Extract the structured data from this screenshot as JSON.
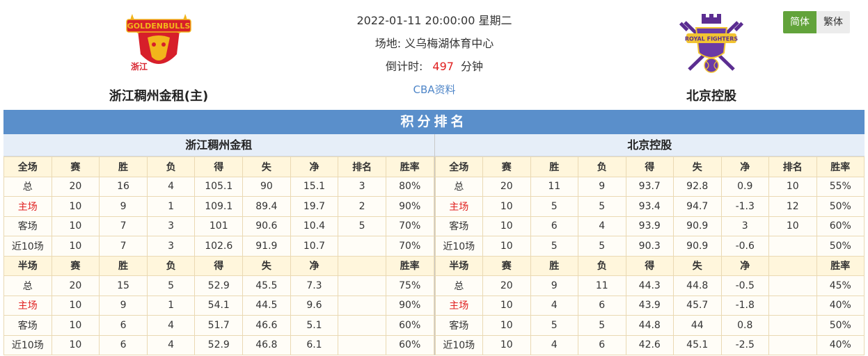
{
  "match": {
    "datetime": "2022-01-11 20:00:00 星期二",
    "venue_label": "场地:",
    "venue": "义乌梅湖体育中心",
    "countdown_label": "倒计时:",
    "countdown_value": "497",
    "countdown_unit": "分钟",
    "link": "CBA资料"
  },
  "home_team": {
    "name": "浙江稠州金租(主)",
    "logo_icon": "golden-bulls-logo",
    "logo_text": "GOLDENBULLS",
    "logo_sub": "浙江"
  },
  "away_team": {
    "name": "北京控股",
    "logo_icon": "royal-fighters-logo",
    "logo_text": "ROYAL FIGHTERS"
  },
  "lang": {
    "simplified": "简体",
    "traditional": "繁体",
    "active": "简体"
  },
  "colors": {
    "banner": "#5a8fcb",
    "active_lang": "#62a33b",
    "highlight": "#e02020",
    "link": "#4f86c8"
  },
  "standings": {
    "title": "积分排名",
    "teams": [
      {
        "name": "浙江稠州金租",
        "full_header": [
          "全场",
          "赛",
          "胜",
          "负",
          "得",
          "失",
          "净",
          "排名",
          "胜率"
        ],
        "full_rows": [
          [
            "总",
            "20",
            "16",
            "4",
            "105.1",
            "90",
            "15.1",
            "3",
            "80%"
          ],
          [
            "主场",
            "10",
            "9",
            "1",
            "109.1",
            "89.4",
            "19.7",
            "2",
            "90%"
          ],
          [
            "客场",
            "10",
            "7",
            "3",
            "101",
            "90.6",
            "10.4",
            "5",
            "70%"
          ],
          [
            "近10场",
            "10",
            "7",
            "3",
            "102.6",
            "91.9",
            "10.7",
            "",
            "70%"
          ]
        ],
        "half_header": [
          "半场",
          "赛",
          "胜",
          "负",
          "得",
          "失",
          "净",
          "",
          "胜率"
        ],
        "half_rows": [
          [
            "总",
            "20",
            "15",
            "5",
            "52.9",
            "45.5",
            "7.3",
            "",
            "75%"
          ],
          [
            "主场",
            "10",
            "9",
            "1",
            "54.1",
            "44.5",
            "9.6",
            "",
            "90%"
          ],
          [
            "客场",
            "10",
            "6",
            "4",
            "51.7",
            "46.6",
            "5.1",
            "",
            "60%"
          ],
          [
            "近10场",
            "10",
            "6",
            "4",
            "52.9",
            "46.8",
            "6.1",
            "",
            "60%"
          ]
        ]
      },
      {
        "name": "北京控股",
        "full_header": [
          "全场",
          "赛",
          "胜",
          "负",
          "得",
          "失",
          "净",
          "排名",
          "胜率"
        ],
        "full_rows": [
          [
            "总",
            "20",
            "11",
            "9",
            "93.7",
            "92.8",
            "0.9",
            "10",
            "55%"
          ],
          [
            "主场",
            "10",
            "5",
            "5",
            "93.4",
            "94.7",
            "-1.3",
            "12",
            "50%"
          ],
          [
            "客场",
            "10",
            "6",
            "4",
            "93.9",
            "90.9",
            "3",
            "10",
            "60%"
          ],
          [
            "近10场",
            "10",
            "5",
            "5",
            "90.3",
            "90.9",
            "-0.6",
            "",
            "50%"
          ]
        ],
        "half_header": [
          "半场",
          "赛",
          "胜",
          "负",
          "得",
          "失",
          "净",
          "",
          "胜率"
        ],
        "half_rows": [
          [
            "总",
            "20",
            "9",
            "11",
            "44.3",
            "44.8",
            "-0.5",
            "",
            "45%"
          ],
          [
            "主场",
            "10",
            "4",
            "6",
            "43.9",
            "45.7",
            "-1.8",
            "",
            "40%"
          ],
          [
            "客场",
            "10",
            "5",
            "5",
            "44.8",
            "44",
            "0.8",
            "",
            "50%"
          ],
          [
            "近10场",
            "10",
            "4",
            "6",
            "42.6",
            "45.1",
            "-2.5",
            "",
            "40%"
          ]
        ]
      }
    ]
  }
}
